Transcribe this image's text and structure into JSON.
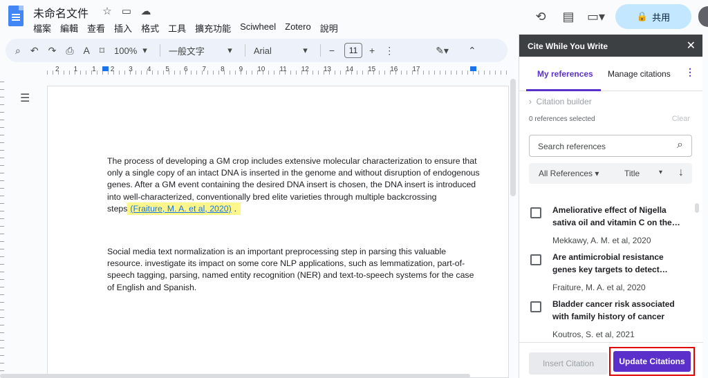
{
  "header": {
    "doc_title": "未命名文件",
    "menu": [
      "檔案",
      "編輯",
      "查看",
      "插入",
      "格式",
      "工具",
      "擴充功能",
      "Sciwheel",
      "Zotero",
      "說明"
    ],
    "share_label": "共用"
  },
  "toolbar": {
    "zoom": "100%",
    "style": "一般文字",
    "font": "Arial",
    "font_size": "11",
    "minus": "−",
    "plus": "+"
  },
  "ruler": {
    "numbers": [
      "2",
      "1",
      "1",
      "2",
      "3",
      "4",
      "5",
      "6",
      "7",
      "8",
      "9",
      "10",
      "11",
      "12",
      "13",
      "14",
      "15",
      "16",
      "17"
    ]
  },
  "document": {
    "p1_text": "The process of developing a GM crop includes extensive molecular characterization to ensure that only a single copy of an intact DNA is inserted in the genome and without disruption of endogenous genes. After a GM event containing the desired DNA insert is chosen, the DNA insert is introduced into well-characterized, conventionally bred elite varieties through multiple backcrossing steps",
    "p1_citation": "(Fraiture, M. A. et al, 2020)",
    "p1_end": ".",
    "p2_text": "Social media text normalization is an important preprocessing step in parsing this valuable resource. investigate its impact on some core NLP applications, such as lemmatization, part-of-speech tagging, parsing, named entity recognition (NER) and text-to-speech systems for the case of English and Spanish."
  },
  "panel": {
    "title": "Cite While You Write",
    "tab_my": "My references",
    "tab_manage": "Manage citations",
    "builder": "Citation builder",
    "selected": "0 references selected",
    "clear": "Clear",
    "search_placeholder": "Search references",
    "filter": "All References",
    "sort_by": "Title",
    "references": [
      {
        "title": "Ameliorative effect of Nigella sativa oil and vitamin C on the…",
        "author": "Mekkawy, A. M. et al, 2020"
      },
      {
        "title": "Are antimicrobial resistance genes key targets to detect…",
        "author": "Fraiture, M. A. et al, 2020"
      },
      {
        "title": "Bladder cancer risk associated with family history of cancer",
        "author": "Koutros, S. et al, 2021"
      }
    ],
    "insert_label": "Insert Citation",
    "update_label": "Update Citations"
  }
}
